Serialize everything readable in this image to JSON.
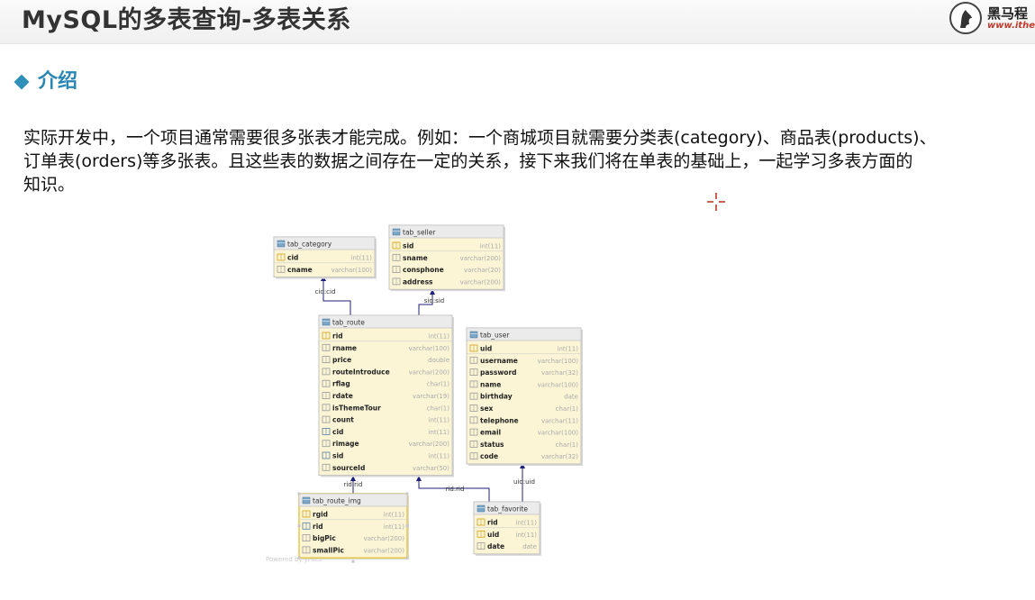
{
  "header": {
    "title": "MySQL的多表查询-多表关系"
  },
  "logo": {
    "brand": "黑马程",
    "url": "www.itheim"
  },
  "section": {
    "label": "介绍"
  },
  "intro": {
    "lines": [
      "实际开发中，一个项目通常需要很多张表才能完成。例如：一个商城项目就需要分类表(category)、商品表(products)、",
      "订单表(orders)等多张表。且这些表的数据之间存在一定的关系，接下来我们将在单表的基础上，一起学习多表方面的",
      "知识。"
    ]
  },
  "diagram": {
    "watermark": "Powered by yFiles",
    "tables": [
      {
        "name": "tab_category",
        "columns": [
          {
            "name": "cid",
            "type": "int(11)",
            "key": "pk"
          },
          {
            "name": "cname",
            "type": "varchar(100)",
            "key": ""
          }
        ]
      },
      {
        "name": "tab_seller",
        "columns": [
          {
            "name": "sid",
            "type": "int(11)",
            "key": "pk"
          },
          {
            "name": "sname",
            "type": "varchar(200)",
            "key": ""
          },
          {
            "name": "consphone",
            "type": "varchar(20)",
            "key": ""
          },
          {
            "name": "address",
            "type": "varchar(200)",
            "key": ""
          }
        ]
      },
      {
        "name": "tab_route",
        "columns": [
          {
            "name": "rid",
            "type": "int(11)",
            "key": "pk"
          },
          {
            "name": "rname",
            "type": "varchar(100)",
            "key": ""
          },
          {
            "name": "price",
            "type": "double",
            "key": ""
          },
          {
            "name": "routeIntroduce",
            "type": "varchar(200)",
            "key": ""
          },
          {
            "name": "rflag",
            "type": "char(1)",
            "key": ""
          },
          {
            "name": "rdate",
            "type": "varchar(19)",
            "key": ""
          },
          {
            "name": "isThemeTour",
            "type": "char(1)",
            "key": ""
          },
          {
            "name": "count",
            "type": "int(11)",
            "key": ""
          },
          {
            "name": "cid",
            "type": "int(11)",
            "key": "fk"
          },
          {
            "name": "rimage",
            "type": "varchar(200)",
            "key": ""
          },
          {
            "name": "sid",
            "type": "int(11)",
            "key": "fk"
          },
          {
            "name": "sourceId",
            "type": "varchar(50)",
            "key": ""
          }
        ]
      },
      {
        "name": "tab_user",
        "columns": [
          {
            "name": "uid",
            "type": "int(11)",
            "key": "pk"
          },
          {
            "name": "username",
            "type": "varchar(100)",
            "key": ""
          },
          {
            "name": "password",
            "type": "varchar(32)",
            "key": ""
          },
          {
            "name": "name",
            "type": "varchar(100)",
            "key": ""
          },
          {
            "name": "birthday",
            "type": "date",
            "key": ""
          },
          {
            "name": "sex",
            "type": "char(1)",
            "key": ""
          },
          {
            "name": "telephone",
            "type": "varchar(11)",
            "key": ""
          },
          {
            "name": "email",
            "type": "varchar(100)",
            "key": ""
          },
          {
            "name": "status",
            "type": "char(1)",
            "key": ""
          },
          {
            "name": "code",
            "type": "varchar(32)",
            "key": ""
          }
        ]
      },
      {
        "name": "tab_route_img",
        "columns": [
          {
            "name": "rgid",
            "type": "int(11)",
            "key": "pk"
          },
          {
            "name": "rid",
            "type": "int(11)",
            "key": "fk"
          },
          {
            "name": "bigPic",
            "type": "varchar(200)",
            "key": ""
          },
          {
            "name": "smallPic",
            "type": "varchar(200)",
            "key": ""
          }
        ]
      },
      {
        "name": "tab_favorite",
        "columns": [
          {
            "name": "rid",
            "type": "int(11)",
            "key": "pk"
          },
          {
            "name": "uid",
            "type": "int(11)",
            "key": "pk"
          },
          {
            "name": "date",
            "type": "date",
            "key": ""
          }
        ]
      }
    ],
    "relations": [
      {
        "label": "cid:cid"
      },
      {
        "label": "sid:sid"
      },
      {
        "label": "rid:rid"
      },
      {
        "label": "rid:rid"
      },
      {
        "label": "uid:uid"
      }
    ]
  },
  "colors": {
    "accent": "#2a86b3",
    "table_bg": "#fbf5d6",
    "table_header": "#ebebeb",
    "selected_border": "#e6c84a",
    "relation": "#1f1f7a"
  }
}
